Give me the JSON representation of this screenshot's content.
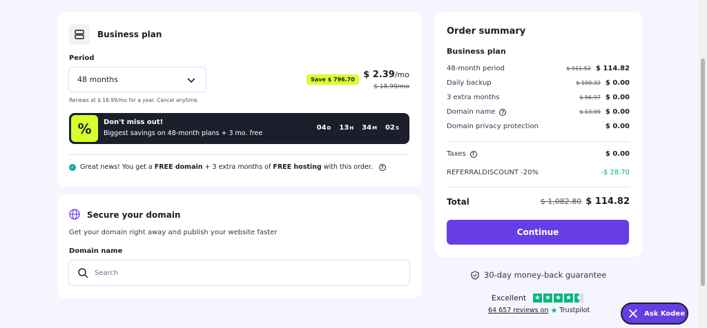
{
  "plan": {
    "title": "Business plan",
    "period_label": "Period",
    "period_value": "48 months",
    "renews": "Renews at $ 16.99/mo for a year. Cancel anytime.",
    "save_badge": "Save $ 796.70",
    "price": "$ 2.39",
    "price_per": "/mo",
    "old_price": "$ 18.99/mo",
    "promo": {
      "icon": "%",
      "title": "Don't miss out!",
      "text": "Biggest savings on 48-month plans + 3 mo. free",
      "days": "04",
      "days_unit": "D",
      "hours": "13",
      "hours_unit": "H",
      "minutes": "34",
      "minutes_unit": "M",
      "seconds": "02",
      "seconds_unit": "S"
    },
    "news": {
      "part1": "Great news! You get a ",
      "bold1": "FREE domain",
      "part2": " + 3 extra months of ",
      "bold2": "FREE hosting",
      "part3": " with this order."
    }
  },
  "domain": {
    "title": "Secure your domain",
    "subtitle": "Get your domain right away and publish your website faster",
    "label": "Domain name",
    "placeholder": "Search"
  },
  "summary": {
    "title": "Order summary",
    "plan": "Business plan",
    "rows": [
      {
        "label": "48-month period",
        "old": "$ 911.52",
        "value": "$ 114.82"
      },
      {
        "label": "Daily backup",
        "old": "$ 100.32",
        "value": "$ 0.00"
      },
      {
        "label": "3 extra months",
        "old": "$ 56.97",
        "value": "$ 0.00"
      },
      {
        "label": "Domain name",
        "old": "$ 13.99",
        "value": "$ 0.00"
      },
      {
        "label": "Domain privacy protection",
        "old": "",
        "value": "$ 0.00"
      }
    ],
    "taxes_label": "Taxes",
    "taxes_value": "$ 0.00",
    "discount_label": "REFERRALDISCOUNT -20%",
    "discount_value": "-$ 28.70",
    "total_label": "Total",
    "total_old": "$ 1,082.80",
    "total_value": "$ 114.82",
    "continue_label": "Continue"
  },
  "guarantee": "30-day money-back guarantee",
  "trustpilot": {
    "rating_text": "Excellent",
    "reviews": "64 657 reviews on",
    "brand": "Trustpilot",
    "rating_stars": 4.5
  },
  "ask_kodee": "Ask Kodee",
  "colors": {
    "accent": "#673de6",
    "lime": "#d7ff2d",
    "green": "#00b090",
    "dark": "#1d1e2c"
  }
}
